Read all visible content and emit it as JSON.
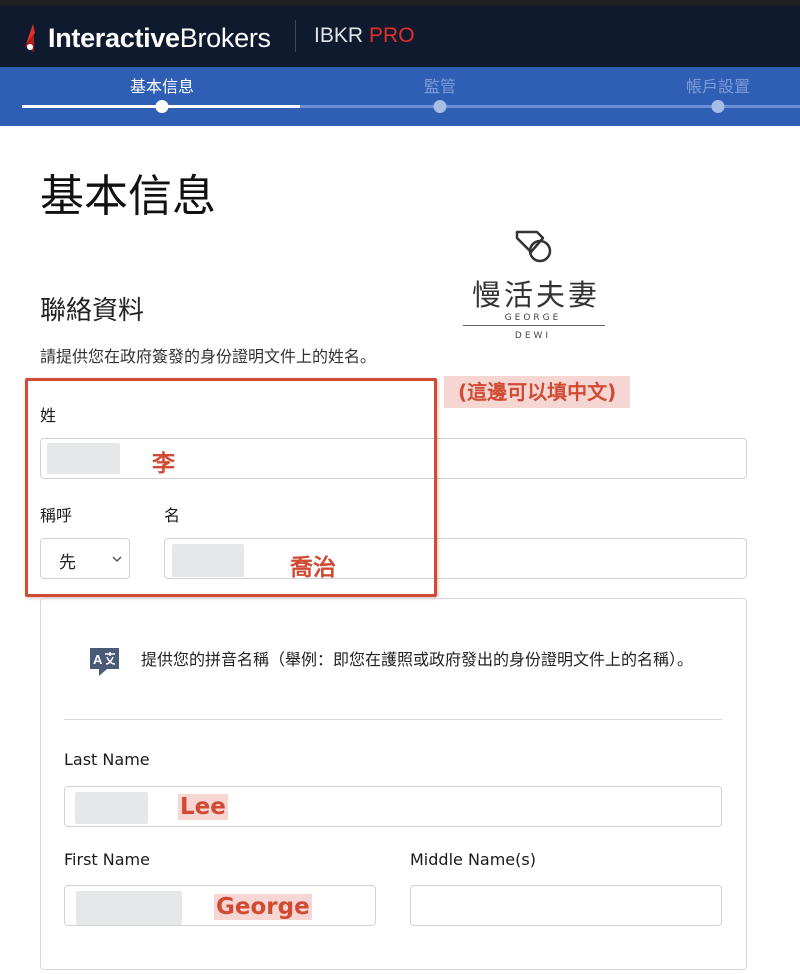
{
  "header": {
    "brand_bold": "Interactive",
    "brand_light": "Brokers",
    "product": "IBKR",
    "product_accent": "PRO"
  },
  "stepper": {
    "steps": [
      {
        "label": "基本信息",
        "active": true
      },
      {
        "label": "監管",
        "active": false
      },
      {
        "label": "帳戶設置",
        "active": false
      }
    ]
  },
  "page": {
    "title": "基本信息",
    "section_title": "聯絡資料",
    "section_desc": "請提供您在政府簽發的身份證明文件上的姓名。"
  },
  "watermark": {
    "title": "慢活夫妻",
    "sub1": "GEORGE",
    "sub2": "DEWI"
  },
  "annotations": {
    "chinese_note": "(這邊可以填中文)",
    "surname_value": "李",
    "given_value": "喬治",
    "last_value": "Lee",
    "first_value": "George"
  },
  "form": {
    "surname_label": "姓",
    "title_label": "稱呼",
    "title_value": "先",
    "given_label": "名",
    "romanized_hint": "提供您的拼音名稱（舉例：即您在護照或政府發出的身份證明文件上的名稱）。",
    "last_name_label": "Last Name",
    "first_name_label": "First Name",
    "middle_name_label": "Middle Name(s)"
  },
  "colors": {
    "header_bg": "#0f1a2e",
    "stepper_bg": "#2f5fb5",
    "accent_red": "#e0302c",
    "annotation_red": "#d14b34",
    "annotation_chip": "#f5d6d2"
  },
  "icons": {
    "logo": "ib-logo-icon",
    "translate": "translate-icon",
    "dropdown": "chevron-down-icon",
    "watermark": "diamond-ring-icon"
  }
}
